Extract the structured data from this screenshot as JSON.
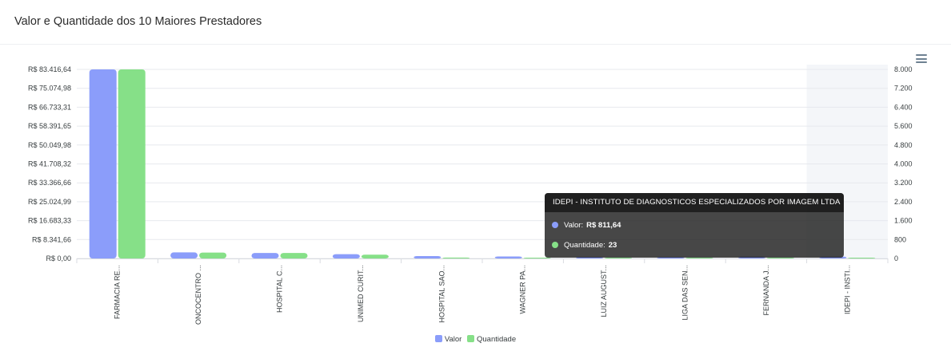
{
  "header": {
    "title": "Valor e Quantidade dos 10 Maiores Prestadores"
  },
  "chart_data": {
    "type": "bar",
    "categories": [
      "FARMACIA RE...",
      "ONCOCENTRO ...",
      "HOSPITAL C...",
      "UNIMED CURIT...",
      "HOSPITAL SAO...",
      "WAGNER PA...",
      "LUIZ AUGUST...",
      "LIGA DAS SEN...",
      "FERNANDA J...",
      "IDEPI - INSTI..."
    ],
    "series": [
      {
        "name": "Valor",
        "axis": "left",
        "color": "#8b9dfa",
        "values": [
          83416.64,
          2700,
          2400,
          1900,
          1050,
          900,
          700,
          650,
          850,
          811.64
        ]
      },
      {
        "name": "Quantidade",
        "axis": "right",
        "color": "#86e088",
        "values": [
          8000,
          250,
          230,
          160,
          40,
          20,
          10,
          10,
          30,
          23
        ]
      }
    ],
    "y_left": {
      "ylim": [
        0,
        83416.64
      ],
      "ticks": [
        "R$ 0,00",
        "R$ 8.341,66",
        "R$ 16.683,33",
        "R$ 25.024,99",
        "R$ 33.366,66",
        "R$ 41.708,32",
        "R$ 50.049,98",
        "R$ 58.391,65",
        "R$ 66.733,31",
        "R$ 75.074,98",
        "R$ 83.416,64"
      ]
    },
    "y_right": {
      "ylim": [
        0,
        8000
      ],
      "ticks": [
        "0",
        "800",
        "1.600",
        "2.400",
        "3.200",
        "4.000",
        "4.800",
        "5.600",
        "6.400",
        "7.200",
        "8.000"
      ]
    },
    "grid": true,
    "highlighted_category": 9,
    "legend_position": "bottom"
  },
  "tooltip": {
    "title": "IDEPI - INSTITUTO DE DIAGNOSTICOS ESPECIALIZADOS POR IMAGEM LTDA",
    "rows": [
      {
        "label": "Valor:",
        "value": "R$ 811,64",
        "color": "#8b9dfa"
      },
      {
        "label": "Quantidade:",
        "value": "23",
        "color": "#86e088"
      }
    ]
  },
  "icons": {
    "menu": "hamburger-menu-icon"
  }
}
